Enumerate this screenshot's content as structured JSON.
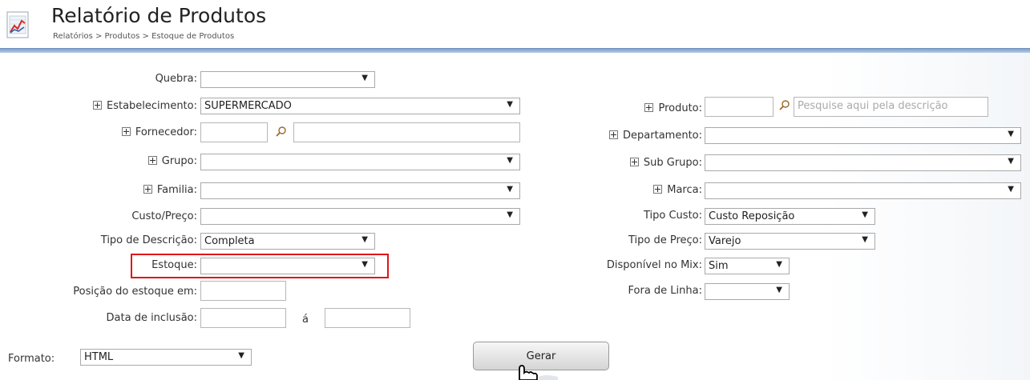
{
  "header": {
    "title": "Relatório de Produtos",
    "breadcrumb": "Relatórios > Produtos > Estoque de Produtos"
  },
  "left": {
    "quebra": {
      "label": "Quebra:",
      "value": ""
    },
    "estabelecimento": {
      "label": "Estabelecimento:",
      "value": "SUPERMERCADO"
    },
    "fornecedor": {
      "label": "Fornecedor:",
      "code": "",
      "description": ""
    },
    "grupo": {
      "label": "Grupo:",
      "value": ""
    },
    "familia": {
      "label": "Familia:",
      "value": ""
    },
    "custo_preco": {
      "label": "Custo/Preço:",
      "value": ""
    },
    "tipo_descricao": {
      "label": "Tipo de Descrição:",
      "value": "Completa"
    },
    "estoque": {
      "label": "Estoque:",
      "value": ""
    },
    "posicao_estoque": {
      "label": "Posição do estoque em:",
      "value": ""
    },
    "data_inclusao": {
      "label": "Data de inclusão:",
      "from": "",
      "separator": "á",
      "to": ""
    }
  },
  "right": {
    "produto": {
      "label": "Produto:",
      "code": "",
      "placeholder": "Pesquise aqui pela descrição"
    },
    "departamento": {
      "label": "Departamento:",
      "value": ""
    },
    "sub_grupo": {
      "label": "Sub Grupo:",
      "value": ""
    },
    "marca": {
      "label": "Marca:",
      "value": ""
    },
    "tipo_custo": {
      "label": "Tipo Custo:",
      "value": "Custo Reposição"
    },
    "tipo_preco": {
      "label": "Tipo de Preço:",
      "value": "Varejo"
    },
    "disponivel_mix": {
      "label": "Disponível no Mix:",
      "value": "Sim"
    },
    "fora_linha": {
      "label": "Fora de Linha:",
      "value": ""
    }
  },
  "footer": {
    "formato": {
      "label": "Formato:",
      "value": "HTML"
    },
    "gerar_label": "Gerar"
  },
  "icons": {
    "report": "chart-report-icon",
    "search": "magnifier-icon",
    "expand": "plus-box-icon",
    "dropdown": "triangle-down-icon",
    "cursor": "hand-pointer-icon"
  },
  "colors": {
    "highlight": "#e01515",
    "separator": "#7ea1c9"
  }
}
